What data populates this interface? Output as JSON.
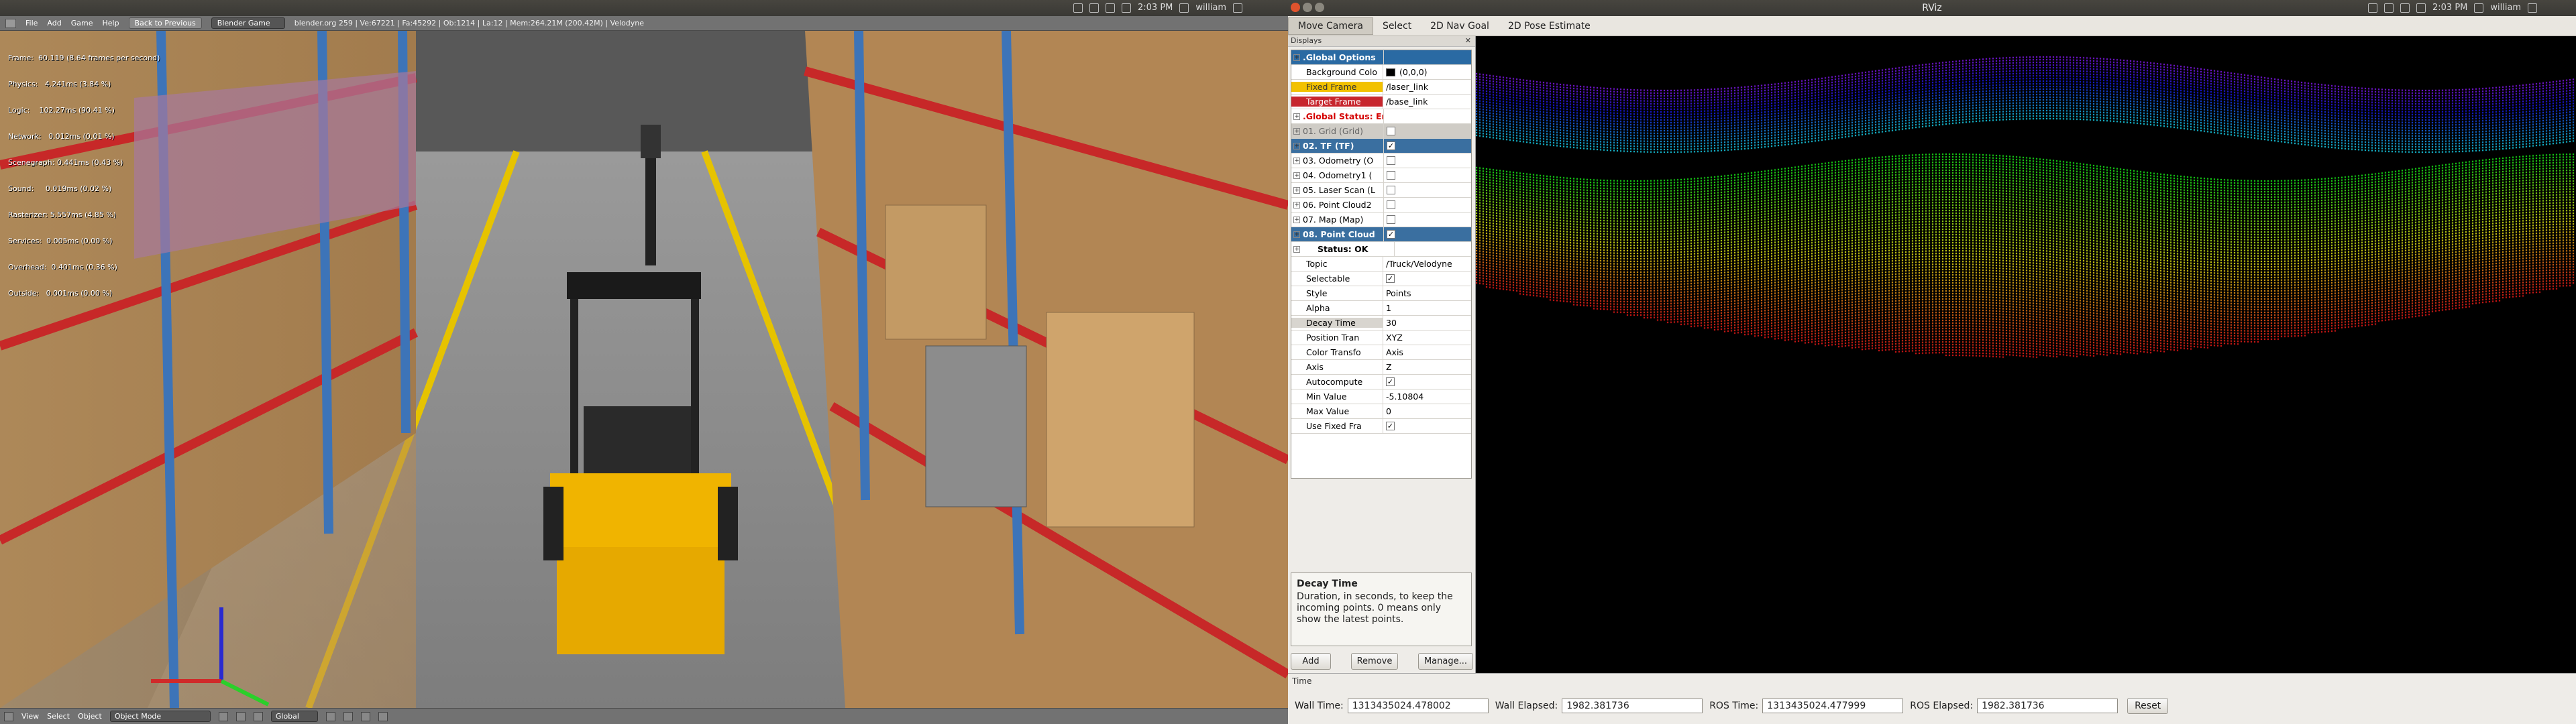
{
  "left_topbar": {
    "clock": "2:03 PM",
    "user": "william"
  },
  "right_topbar": {
    "title": "RViz",
    "clock": "2:03 PM",
    "user": "william"
  },
  "blender": {
    "menu": [
      "File",
      "Add",
      "Game",
      "Help"
    ],
    "back_button": "Back to Previous",
    "engine": "Blender Game",
    "info": "blender.org 259 | Ve:67221 | Fa:45292 | Ob:1214 | La:12 | Mem:264.21M (200.42M) | Velodyne",
    "stats": [
      "Frame:  60.119 (8.64 frames per second)",
      "Physics:   4.241ms (3.84 %)",
      "Logic:    102.27ms (90.41 %)",
      "Network:   0.012ms (0.01 %)",
      "Scenegraph: 0.441ms (0.43 %)",
      "Sound:     0.019ms (0.02 %)",
      "Rasterizer: 5.557ms (4.85 %)",
      "Services:  0.005ms (0.00 %)",
      "Overhead:  0.401ms (0.36 %)",
      "Outside:   0.001ms (0.00 %)"
    ],
    "footer": {
      "menus": [
        "View",
        "Select",
        "Object"
      ],
      "mode": "Object Mode",
      "orientation": "Global"
    }
  },
  "rviz": {
    "tools": [
      "Move Camera",
      "Select",
      "2D Nav Goal",
      "2D Pose Estimate"
    ],
    "displays_title": "Displays",
    "tree": [
      {
        "label": ".Global Options",
        "kind": "group"
      },
      {
        "label": "Background Colo",
        "value": "(0,0,0)",
        "kind": "sub",
        "swatch": "#000000"
      },
      {
        "label": "Fixed Frame",
        "value": "/laser_link",
        "kind": "sub",
        "hl": "y"
      },
      {
        "label": "Target Frame",
        "value": "/base_link",
        "kind": "sub",
        "hl": "r"
      },
      {
        "label": ".Global Status: Error",
        "kind": "err"
      },
      {
        "label": "01. Grid (Grid)",
        "kind": "grey",
        "cb": false
      },
      {
        "label": "02. TF (TF)",
        "kind": "sel",
        "cb": true
      },
      {
        "label": "03. Odometry (O",
        "kind": "item",
        "cb": false
      },
      {
        "label": "04. Odometry1 (",
        "kind": "item",
        "cb": false
      },
      {
        "label": "05. Laser Scan (L",
        "kind": "item",
        "cb": false
      },
      {
        "label": "06. Point Cloud2",
        "kind": "item",
        "cb": false
      },
      {
        "label": "07. Map (Map)",
        "kind": "item",
        "cb": false
      },
      {
        "label": "08. Point Cloud",
        "kind": "sel",
        "cb": true
      },
      {
        "label": "Status: OK",
        "kind": "status"
      },
      {
        "label": "Topic",
        "value": "/Truck/Velodyne",
        "kind": "sub"
      },
      {
        "label": "Selectable",
        "kind": "sub",
        "cb": true
      },
      {
        "label": "Style",
        "value": "Points",
        "kind": "sub"
      },
      {
        "label": "Alpha",
        "value": "1",
        "kind": "sub"
      },
      {
        "label": "Decay Time",
        "value": "30",
        "kind": "sub",
        "hl": "g"
      },
      {
        "label": "Position Tran",
        "value": "XYZ",
        "kind": "sub"
      },
      {
        "label": "Color Transfo",
        "value": "Axis",
        "kind": "sub"
      },
      {
        "label": "Axis",
        "value": "Z",
        "kind": "sub"
      },
      {
        "label": "Autocompute",
        "kind": "sub",
        "cb": true
      },
      {
        "label": "Min Value",
        "value": "-5.10804",
        "kind": "sub"
      },
      {
        "label": "Max Value",
        "value": "0",
        "kind": "sub"
      },
      {
        "label": "Use Fixed Fra",
        "kind": "sub",
        "cb": true
      }
    ],
    "description": {
      "title": "Decay Time",
      "text": "Duration, in seconds, to keep the incoming points. 0 means only show the latest points."
    },
    "buttons": {
      "add": "Add",
      "remove": "Remove",
      "manage": "Manage..."
    },
    "time": {
      "title": "Time",
      "wall_time_label": "Wall Time:",
      "wall_time": "1313435024.478002",
      "wall_elapsed_label": "Wall Elapsed:",
      "wall_elapsed": "1982.381736",
      "ros_time_label": "ROS Time:",
      "ros_time": "1313435024.477999",
      "ros_elapsed_label": "ROS Elapsed:",
      "ros_elapsed": "1982.381736",
      "reset": "Reset"
    }
  }
}
